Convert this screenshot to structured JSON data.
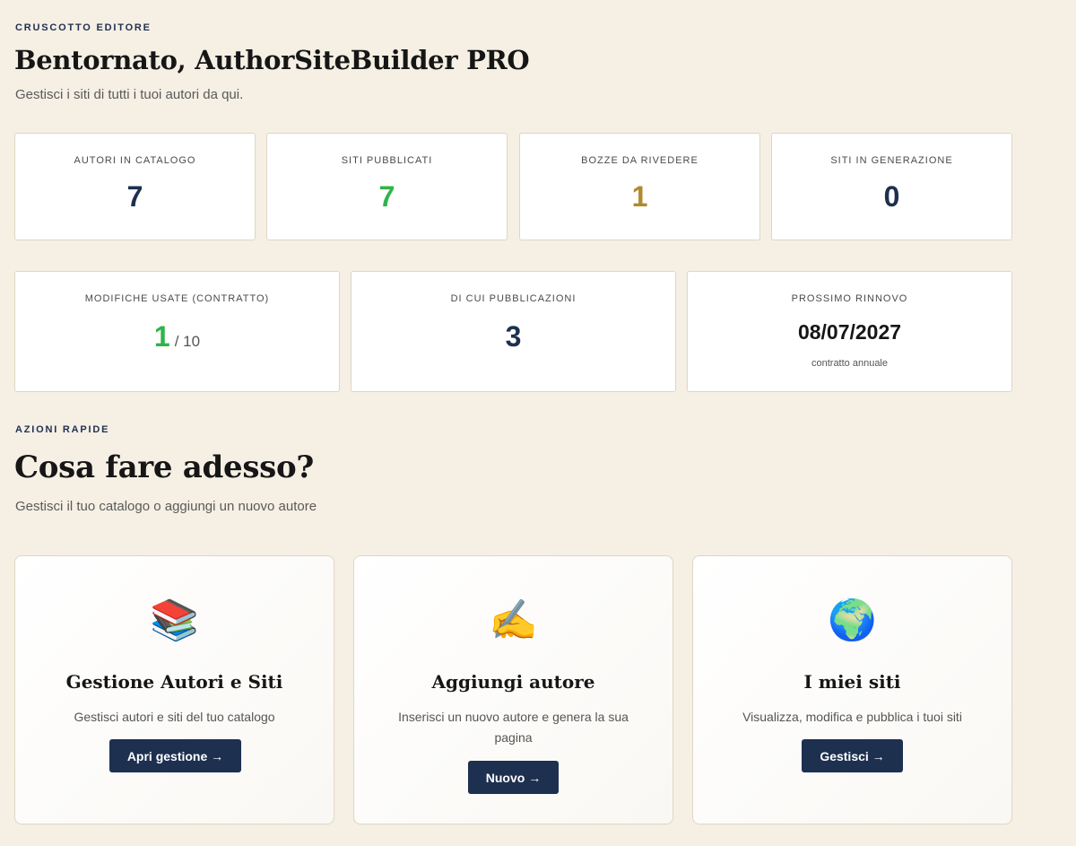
{
  "header": {
    "eyebrow": "CRUSCOTTO EDITORE",
    "title": "Bentornato, AuthorSiteBuilder PRO",
    "subtitle": "Gestisci i siti di tutti i tuoi autori da qui."
  },
  "stats_row1": [
    {
      "label": "AUTORI IN CATALOGO",
      "value": "7",
      "color": "#1d3050"
    },
    {
      "label": "SITI PUBBLICATI",
      "value": "7",
      "color": "#2fb44a"
    },
    {
      "label": "BOZZE DA RIVEDERE",
      "value": "1",
      "color": "#b08a2e"
    },
    {
      "label": "SITI IN GENERAZIONE",
      "value": "0",
      "color": "#1d3050"
    }
  ],
  "stats_row2": {
    "modifiche": {
      "label": "MODIFICHE USATE (CONTRATTO)",
      "value": "1",
      "total": "/ 10",
      "color": "#2fb44a"
    },
    "pubblicazioni": {
      "label": "DI CUI PUBBLICAZIONI",
      "value": "3",
      "color": "#1d3050"
    },
    "rinnovo": {
      "label": "PROSSIMO RINNOVO",
      "value": "08/07/2027",
      "sub": "contratto annuale"
    }
  },
  "actions": {
    "eyebrow": "AZIONI RAPIDE",
    "title": "Cosa fare adesso?",
    "subtitle": "Gestisci il tuo catalogo o aggiungi un nuovo autore",
    "cards": [
      {
        "icon": "📚",
        "icon_name": "books-icon",
        "title": "Gestione Autori e Siti",
        "desc": "Gestisci autori e siti del tuo catalogo",
        "button": "Apri gestione →"
      },
      {
        "icon": "✍️",
        "icon_name": "writing-hand-icon",
        "title": "Aggiungi autore",
        "desc": "Inserisci un nuovo autore e genera la sua pagina",
        "button": "Nuovo →"
      },
      {
        "icon": "🌍",
        "icon_name": "globe-icon",
        "title": "I miei siti",
        "desc": "Visualizza, modifica e pubblica i tuoi siti",
        "button": "Gestisci →"
      }
    ]
  }
}
